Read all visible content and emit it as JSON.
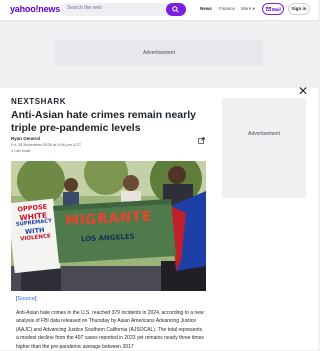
{
  "header": {
    "logo": "yahoo!news",
    "search_placeholder": "Search the web",
    "nav": [
      "News",
      "Finance",
      "More"
    ],
    "mail_label": "Mail",
    "signin_label": "Sign in"
  },
  "ads": {
    "top_label": "Advertisement",
    "side_label": "Advertisement"
  },
  "article": {
    "brand": "NEXTSHARK",
    "title": "Anti-Asian hate crimes remain nearly triple pre-pandemic levels",
    "author": "Ryan General",
    "date": "Fri, 28 November 2025 at 9:06 pm UTC",
    "read_time": "2 min read",
    "source_open": "[",
    "source_link": "Source",
    "source_close": "]",
    "body": "Anti-Asian hate crimes in the U.S. reached 379 incidents in 2024, according to a new analysis of FBI data released on Thursday by Asian Americans Advancing Justice (AAJC) and Advancing Justice Southern California (AJSOCAL). The total represents a modest decline from the 407 cases reported in 2023 yet remains nearly three times higher than the pre-pandemic average between 2017"
  },
  "photo": {
    "sign_left": [
      "OPPOSE",
      "WHITE",
      "SUPREMACY",
      "WITH",
      "VIOLENCE"
    ],
    "banner_top": "MIGRANTE",
    "banner_bottom": "LOS ANGELES"
  },
  "colors": {
    "brand_purple": "#6001d2",
    "search_button": "#7b1fe0",
    "link_blue": "#0f69ff"
  }
}
